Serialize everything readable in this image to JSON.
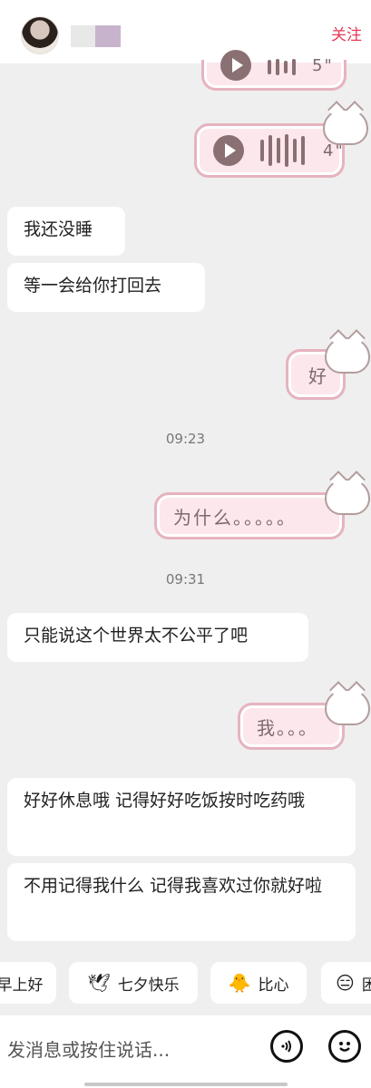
{
  "header": {
    "follow_label": "关注"
  },
  "messages": {
    "voice_top_duration": "5\"",
    "voice_duration": "4\"",
    "m1": "我还没睡",
    "m2": "等一会给你打回去",
    "sticker1": "好",
    "time1": "09:23",
    "sticker2": "为什么。。。。。",
    "time2": "09:31",
    "m3": "只能说这个世界太不公平了吧",
    "sticker3": "我。。。",
    "m4": "好好休息哦 记得好好吃饭按时吃药哦",
    "m5": "不用记得我什么 记得我喜欢过你就好啦"
  },
  "quick_replies": [
    {
      "label": "早上好",
      "icon": ""
    },
    {
      "label": "七夕快乐",
      "icon": "🕊"
    },
    {
      "label": "比心",
      "icon": "🐥"
    },
    {
      "label": "困",
      "icon": "😑"
    }
  ],
  "composer": {
    "placeholder": "发消息或按住说话...",
    "voice_icon": "voice-icon",
    "emoji_icon": "smile-icon"
  },
  "colors": {
    "accent": "#e73a56",
    "sticker_fill": "#fbe7ec",
    "sticker_border": "#e6b3bf"
  }
}
